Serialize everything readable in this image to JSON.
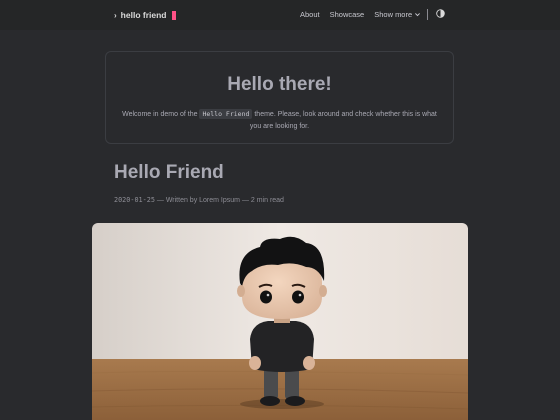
{
  "header": {
    "logo_text": "hello friend",
    "nav": [
      {
        "label": "About"
      },
      {
        "label": "Showcase"
      },
      {
        "label": "Show more"
      }
    ]
  },
  "hero": {
    "title": "Hello there!",
    "text_before": "Welcome in demo of the",
    "code": "Hello Friend",
    "text_after": "theme. Please, look around and check whether this is what you are looking for."
  },
  "post": {
    "title": "Hello Friend",
    "date": "2020-01-25",
    "meta": "— Written by Lorem Ipsum — 2 min read"
  },
  "colors": {
    "background": "#292a2d",
    "header": "#252627",
    "accent": "#fe5186"
  }
}
